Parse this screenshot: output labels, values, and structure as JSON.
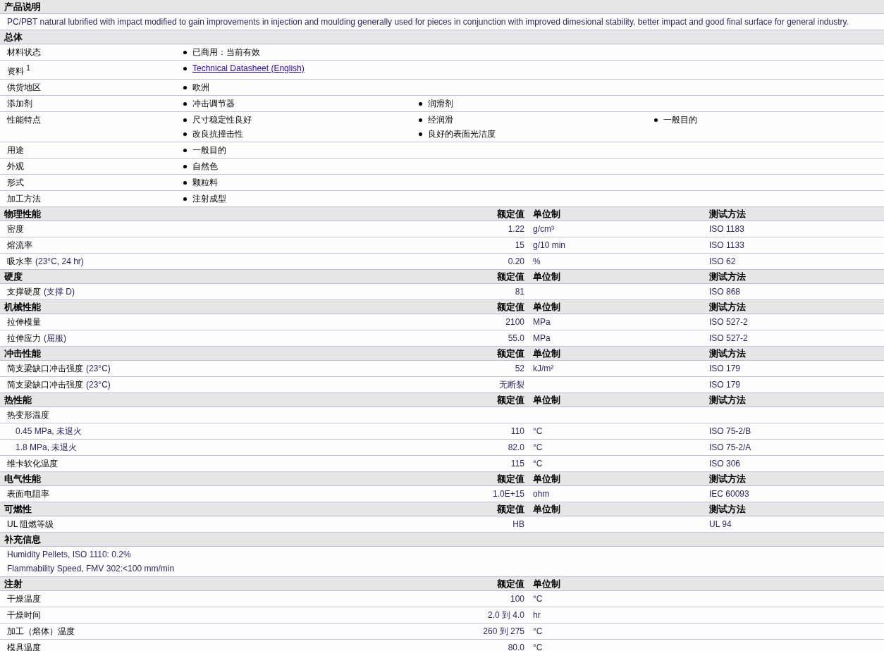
{
  "sections": [
    {
      "title": "产品说明",
      "kind": "text",
      "text": "PC/PBT natural lubrified with impact modified to gain improvements in injection and moulding generally used for pieces in conjunction with improved dimesional stability, better impact and good final surface for general industry."
    },
    {
      "title": "总体",
      "kind": "general",
      "rows": [
        {
          "label": "材料状态",
          "items": [
            {
              "kind": "text",
              "text": "已商用：当前有效"
            }
          ]
        },
        {
          "label": "资料 $^{1}$",
          "items": [
            {
              "kind": "link",
              "text": "Technical Datasheet (English)"
            }
          ]
        },
        {
          "label": "供货地区",
          "items": [
            {
              "kind": "text",
              "text": "欧洲"
            }
          ]
        },
        {
          "label": "添加剂",
          "items": [
            {
              "kind": "text",
              "text": "冲击调节器"
            },
            {
              "kind": "text",
              "text": "润滑剂"
            }
          ]
        },
        {
          "label": "性能特点",
          "items": [
            {
              "kind": "text",
              "text": "尺寸稳定性良好"
            },
            {
              "kind": "text",
              "text": "经润滑"
            },
            {
              "kind": "text",
              "text": "一般目的"
            },
            {
              "kind": "text",
              "text": "改良抗撞击性"
            },
            {
              "kind": "text",
              "text": "良好的表面光洁度"
            }
          ]
        },
        {
          "label": "用途",
          "items": [
            {
              "kind": "text",
              "text": "一般目的"
            }
          ]
        },
        {
          "label": "外观",
          "items": [
            {
              "kind": "text",
              "text": "自然色"
            }
          ]
        },
        {
          "label": "形式",
          "items": [
            {
              "kind": "text",
              "text": "颗粒料"
            }
          ]
        },
        {
          "label": "加工方法",
          "items": [
            {
              "kind": "text",
              "text": "注射成型"
            }
          ]
        }
      ]
    },
    {
      "title": "物理性能",
      "kind": "properties",
      "columns": {
        "value": "额定值",
        "unit": "单位制",
        "method": "测试方法"
      },
      "rows": [
        {
          "label": "密度",
          "value": "1.22",
          "unit": "g/cm³",
          "method": "ISO 1183"
        },
        {
          "label": "熔流率",
          "value": "15",
          "unit": "g/10 min",
          "method": "ISO 1133"
        },
        {
          "label": "吸水率",
          "condition": "(23°C, 24 hr)",
          "value": "0.20",
          "unit": "%",
          "method": "ISO 62"
        }
      ]
    },
    {
      "title": "硬度",
      "kind": "properties",
      "columns": {
        "value": "额定值",
        "unit": "单位制",
        "method": "测试方法"
      },
      "rows": [
        {
          "label": "支撑硬度",
          "condition": "(支撑 D)",
          "value": "81",
          "method": "ISO 868"
        }
      ]
    },
    {
      "title": "机械性能",
      "kind": "properties",
      "columns": {
        "value": "额定值",
        "unit": "单位制",
        "method": "测试方法"
      },
      "rows": [
        {
          "label": "拉伸模量",
          "value": "2100",
          "unit": "MPa",
          "method": "ISO 527-2"
        },
        {
          "label": "拉伸应力",
          "condition": "(屈服)",
          "value": "55.0",
          "unit": "MPa",
          "method": "ISO 527-2"
        }
      ]
    },
    {
      "title": "冲击性能",
      "kind": "properties",
      "columns": {
        "value": "额定值",
        "unit": "单位制",
        "method": "测试方法"
      },
      "rows": [
        {
          "label": "简支梁缺口冲击强度",
          "condition": "(23°C)",
          "value": "52",
          "unit": "kJ/m²",
          "method": "ISO 179"
        },
        {
          "label": "简支梁缺口冲击强度",
          "condition": "(23°C)",
          "value": "无断裂",
          "method": "ISO 179"
        }
      ]
    },
    {
      "title": "热性能",
      "kind": "properties",
      "columns": {
        "value": "额定值",
        "unit": "单位制",
        "method": "测试方法"
      },
      "rows": [
        {
          "label": "热变形温度",
          "children": [
            {
              "label": "0.45 MPa, 未退火",
              "value": "110",
              "unit": "°C",
              "method": "ISO 75-2/B"
            },
            {
              "label": "1.8 MPa, 未退火",
              "value": "82.0",
              "unit": "°C",
              "method": "ISO 75-2/A"
            }
          ]
        },
        {
          "label": "维卡软化温度",
          "value": "115",
          "unit": "°C",
          "method": "ISO 306"
        }
      ]
    },
    {
      "title": "电气性能",
      "kind": "properties",
      "columns": {
        "value": "额定值",
        "unit": "单位制",
        "method": "测试方法"
      },
      "rows": [
        {
          "label": "表面电阻率",
          "value": "1.0E+15",
          "unit": "ohm",
          "method": "IEC 60093"
        }
      ]
    },
    {
      "title": "可燃性",
      "kind": "properties",
      "columns": {
        "value": "额定值",
        "unit": "单位制",
        "method": "测试方法"
      },
      "rows": [
        {
          "label": "UL 阻燃等级",
          "value": "HB",
          "method": "UL 94"
        }
      ]
    },
    {
      "title": "补充信息",
      "kind": "notes",
      "notes": [
        "Humidity Pellets, ISO 1110: 0.2%",
        "Flammability Speed, FMV 302:<100 mm/min"
      ]
    },
    {
      "title": "注射",
      "kind": "properties",
      "columns": {
        "value": "额定值",
        "unit": "单位制"
      },
      "rows": [
        {
          "label": "干燥温度",
          "value": "100",
          "unit": "°C"
        },
        {
          "label": "干燥时间",
          "value": "2.0 到  4.0",
          "unit": "hr"
        },
        {
          "label": "加工（熔体）温度",
          "value": "260 到  275",
          "unit": "°C"
        },
        {
          "label": "模具温度",
          "value": "80.0",
          "unit": "°C"
        }
      ]
    }
  ]
}
